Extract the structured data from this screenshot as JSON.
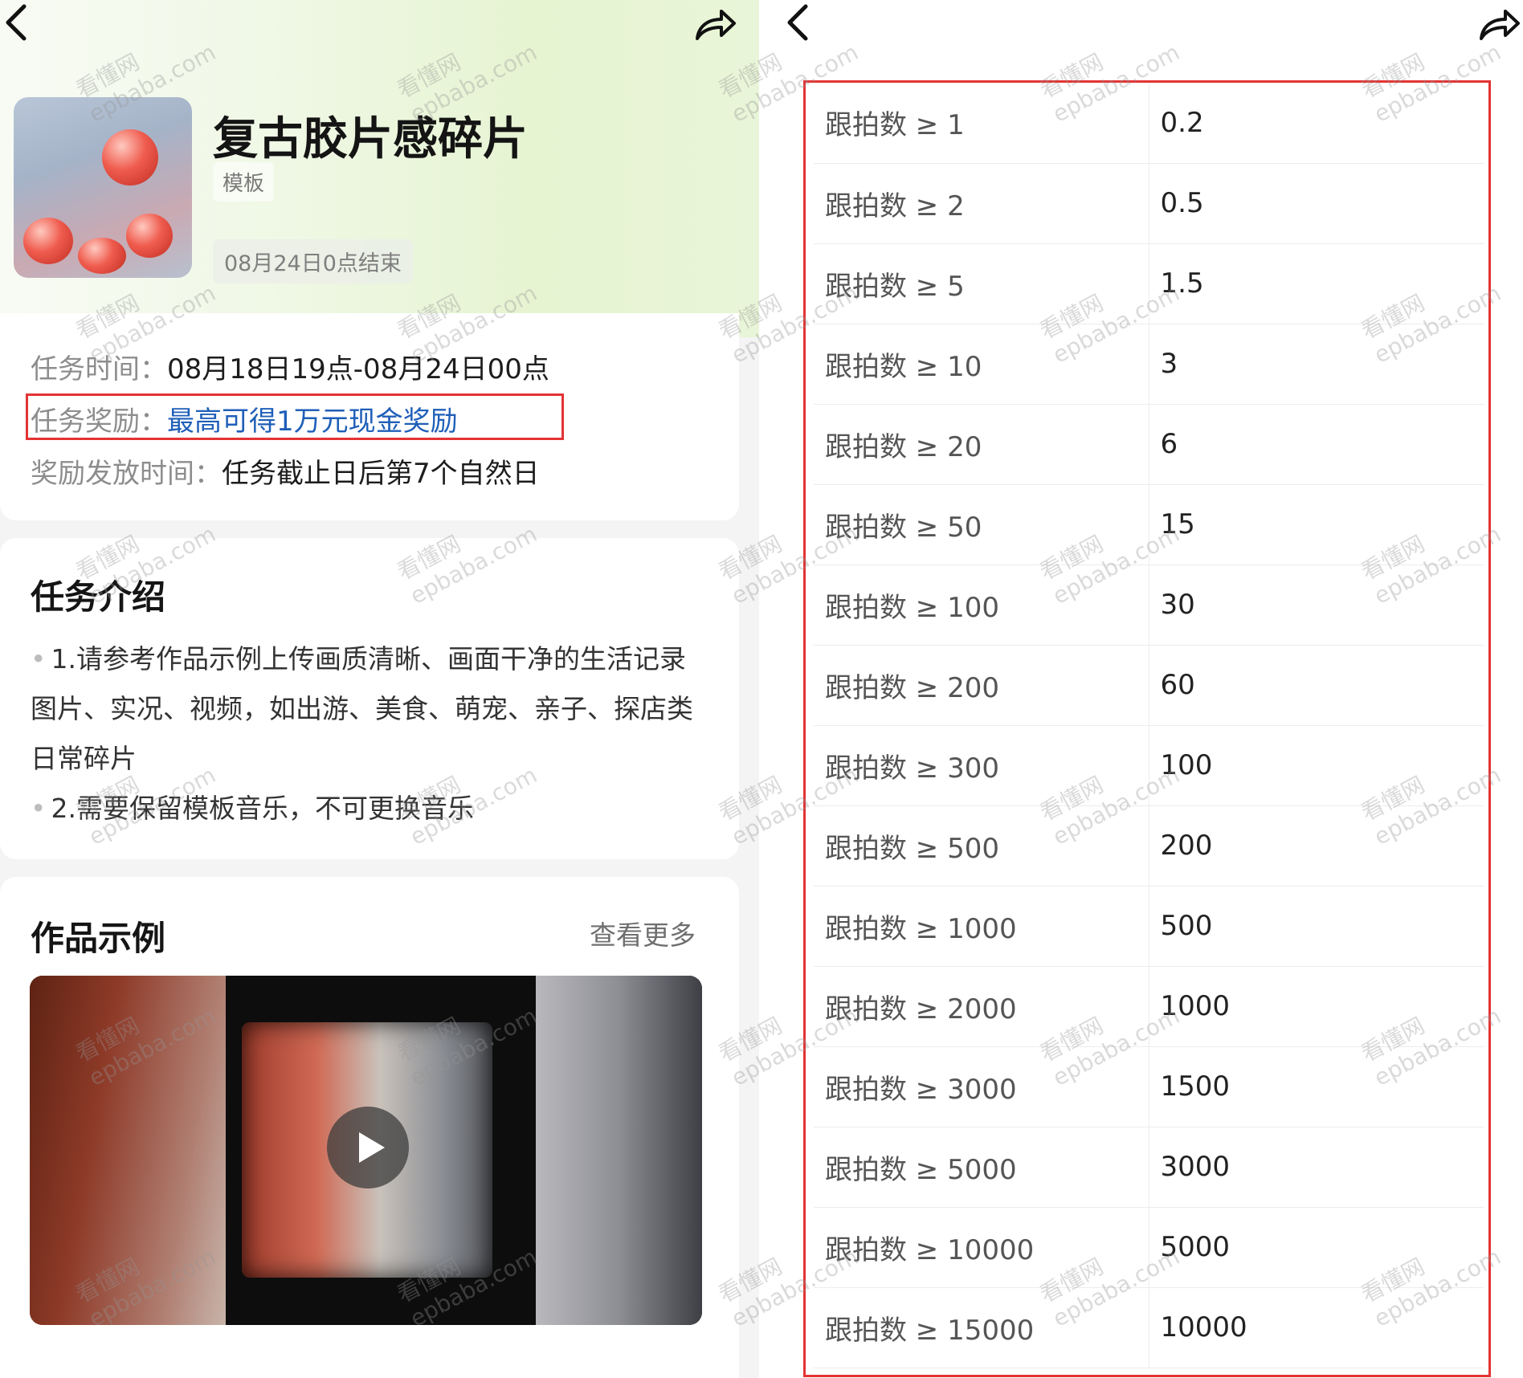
{
  "left": {
    "title": "复古胶片感碎片",
    "tag": "模板",
    "deadline": "08月24日0点结束",
    "info": {
      "task_time_label": "任务时间：",
      "task_time_value": "08月18日19点-08月24日00点",
      "reward_label": "任务奖励：",
      "reward_value": "最高可得1万元现金奖励",
      "payout_label": "奖励发放时间：",
      "payout_value": "任务截止日后第7个自然日"
    },
    "intro": {
      "title": "任务介绍",
      "items": [
        "1.请参考作品示例上传画质清晰、画面干净的生活记录图片、实况、视频，如出游、美食、萌宠、亲子、探店类日常碎片",
        "2.需要保留模板音乐，不可更换音乐"
      ]
    },
    "examples": {
      "title": "作品示例",
      "more": "查看更多"
    }
  },
  "right": {
    "rows": [
      {
        "condition": "跟拍数 ≥ 1",
        "reward": "0.2"
      },
      {
        "condition": "跟拍数 ≥ 2",
        "reward": "0.5"
      },
      {
        "condition": "跟拍数 ≥ 5",
        "reward": "1.5"
      },
      {
        "condition": "跟拍数 ≥ 10",
        "reward": "3"
      },
      {
        "condition": "跟拍数 ≥ 20",
        "reward": "6"
      },
      {
        "condition": "跟拍数 ≥ 50",
        "reward": "15"
      },
      {
        "condition": "跟拍数 ≥ 100",
        "reward": "30"
      },
      {
        "condition": "跟拍数 ≥ 200",
        "reward": "60"
      },
      {
        "condition": "跟拍数 ≥ 300",
        "reward": "100"
      },
      {
        "condition": "跟拍数 ≥ 500",
        "reward": "200"
      },
      {
        "condition": "跟拍数 ≥ 1000",
        "reward": "500"
      },
      {
        "condition": "跟拍数 ≥ 2000",
        "reward": "1000"
      },
      {
        "condition": "跟拍数 ≥ 3000",
        "reward": "1500"
      },
      {
        "condition": "跟拍数 ≥ 5000",
        "reward": "3000"
      },
      {
        "condition": "跟拍数 ≥ 10000",
        "reward": "5000"
      },
      {
        "condition": "跟拍数 ≥ 15000",
        "reward": "10000"
      }
    ]
  },
  "watermark": {
    "line1": "看懂网",
    "line2": "epbaba.com"
  },
  "icons": {
    "back": "chevron-left-icon",
    "share": "share-arrow-icon",
    "play": "play-icon"
  },
  "colors": {
    "highlight": "#e33333",
    "link": "#1f5fb8"
  }
}
